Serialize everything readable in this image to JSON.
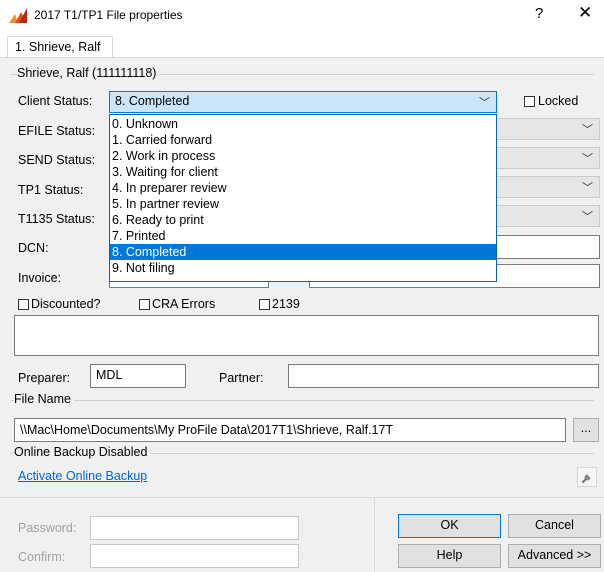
{
  "window": {
    "title": "2017 T1/TP1 File properties",
    "help_glyph": "?",
    "close_glyph": "✕",
    "app_icon": "profile-app-icon"
  },
  "tab": {
    "label": "1. Shrieve, Ralf"
  },
  "group": {
    "title": "Shrieve, Ralf (111111118)"
  },
  "client_status": {
    "label": "Client Status:",
    "value": "8. Completed",
    "options": [
      "0. Unknown",
      "1. Carried forward",
      "2. Work in process",
      "3. Waiting for client",
      "4. In preparer review",
      "5. In partner review",
      "6. Ready to print",
      "7. Printed",
      "8. Completed",
      "9. Not filing"
    ],
    "selected_index": 8
  },
  "locked": {
    "label": "Locked",
    "checked": false
  },
  "efile_status": {
    "label": "EFILE Status:"
  },
  "send_status": {
    "label": "SEND Status:"
  },
  "tp1_status": {
    "label": "TP1 Status:"
  },
  "t1135_status": {
    "label": "T1135 Status:"
  },
  "dcn": {
    "label": "DCN:"
  },
  "invoice": {
    "label": "Invoice:"
  },
  "checkboxes": {
    "discounted": "Discounted?",
    "cra_errors": "CRA Errors",
    "form_2139": "2139"
  },
  "preparer": {
    "label": "Preparer:",
    "value": "MDL"
  },
  "partner": {
    "label": "Partner:",
    "value": ""
  },
  "file_name": {
    "label": "File Name",
    "value": "\\\\Mac\\Home\\Documents\\My ProFile Data\\2017T1\\Shrieve, Ralf.17T",
    "browse_label": "..."
  },
  "online_backup": {
    "label": "Online Backup Disabled",
    "link": "Activate Online Backup",
    "settings_icon": "wrench-icon"
  },
  "password": {
    "label": "Password:",
    "confirm_label": "Confirm:"
  },
  "buttons": {
    "ok": "OK",
    "cancel": "Cancel",
    "help": "Help",
    "advanced": "Advanced >>"
  },
  "colors": {
    "selection": "#0078d7",
    "link": "#0066cc",
    "dialog_bg": "#f0f0f0"
  }
}
